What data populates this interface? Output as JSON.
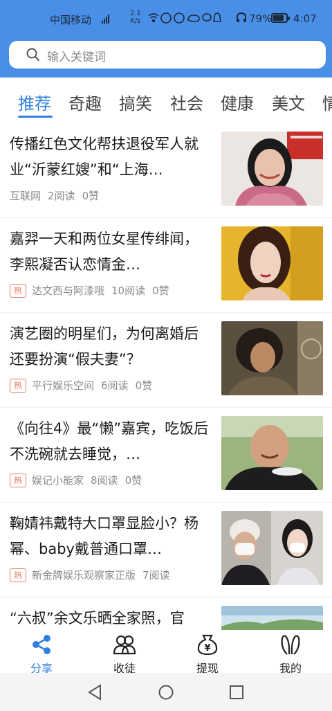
{
  "status_bar": {
    "carrier": "中国移动",
    "network_badge": "4G",
    "speed_value": "2.1",
    "speed_unit": "K/s",
    "battery_percent": "79%",
    "time": "4:07"
  },
  "search": {
    "placeholder": "输入关键词"
  },
  "tabs": [
    {
      "label": "推荐",
      "active": true
    },
    {
      "label": "奇趣"
    },
    {
      "label": "搞笑"
    },
    {
      "label": "社会"
    },
    {
      "label": "健康"
    },
    {
      "label": "美文"
    },
    {
      "label": "情"
    }
  ],
  "feed": [
    {
      "title": "传播红色文化帮扶退役军人就业“沂蒙红嫂”和“上海…",
      "hot": false,
      "source": "互联网",
      "reads": "2阅读",
      "likes": "0赞"
    },
    {
      "title": "嘉羿一天和两位女星传绯闻，李熙凝否认恋情金…",
      "hot": true,
      "hot_label": "热",
      "source": "达文西与阿漆哦",
      "reads": "10阅读",
      "likes": "0赞"
    },
    {
      "title": "演艺圈的明星们，为何离婚后还要扮演“假夫妻”？",
      "hot": true,
      "hot_label": "热",
      "source": "平行娱乐空间",
      "reads": "6阅读",
      "likes": "0赞"
    },
    {
      "title": "《向往4》最“懒”嘉宾，吃饭后不洗碗就去睡觉，…",
      "hot": true,
      "hot_label": "热",
      "source": "娱记小能家",
      "reads": "8阅读",
      "likes": "0赞"
    },
    {
      "title": "鞠婧祎戴特大口罩显脸小？杨幂、baby戴普通口罩…",
      "hot": true,
      "hot_label": "热",
      "source": "新金牌娱乐观察家正版",
      "reads": "7阅读",
      "likes": ""
    },
    {
      "title": "“六叔”余文乐晒全家照，官",
      "hot": false,
      "source": "",
      "reads": "",
      "likes": ""
    }
  ],
  "bottom_nav": [
    {
      "label": "分享",
      "icon": "share-icon",
      "active": true
    },
    {
      "label": "收徒",
      "icon": "people-icon"
    },
    {
      "label": "提现",
      "icon": "money-bag-icon"
    },
    {
      "label": "我的",
      "icon": "rabbit-ears-icon"
    }
  ],
  "colors": {
    "header_blue": "#4a8fe7",
    "accent": "#2f7fe0",
    "hot_tag": "#e2795e"
  }
}
